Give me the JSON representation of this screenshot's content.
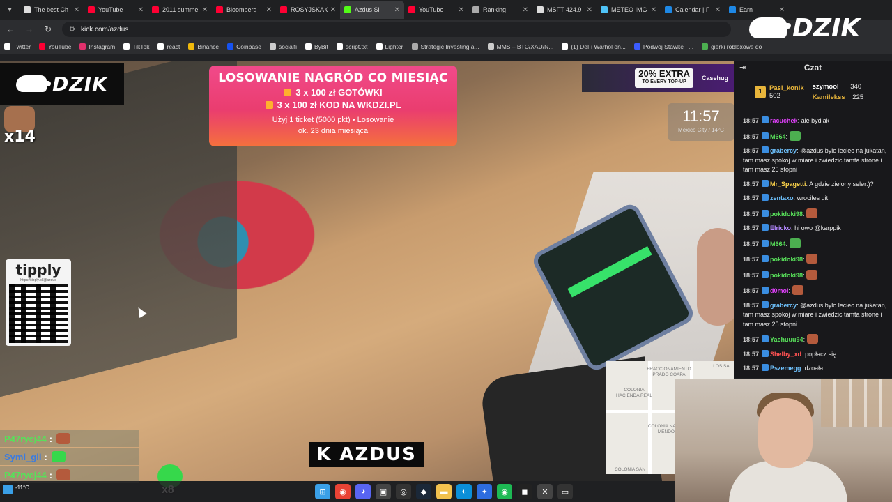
{
  "browser": {
    "tabs": [
      {
        "label": "The best Ch",
        "color": "#dddddd"
      },
      {
        "label": "YouTube",
        "color": "#ff0033"
      },
      {
        "label": "2011 summe",
        "color": "#ff0033"
      },
      {
        "label": "Bloomberg",
        "color": "#ff0033"
      },
      {
        "label": "ROSYJSKA G",
        "color": "#ff0033"
      },
      {
        "label": "Azdus Si",
        "color": "#53fc18"
      },
      {
        "label": "YouTube",
        "color": "#ff0033"
      },
      {
        "label": "Ranking",
        "color": "#aaaaaa"
      },
      {
        "label": "MSFT 424.9",
        "color": "#dddddd"
      },
      {
        "label": "METEO IMG",
        "color": "#4fc3f7"
      },
      {
        "label": "Calendar | F",
        "color": "#1e88e5"
      },
      {
        "label": "Earn",
        "color": "#1e88e5"
      }
    ],
    "active_tab_index": 5,
    "url": "kick.com/azdus",
    "bookmarks": [
      {
        "label": "Twitter",
        "color": "#ffffff"
      },
      {
        "label": "YouTube",
        "color": "#ff0033"
      },
      {
        "label": "Instagram",
        "color": "#e1306c"
      },
      {
        "label": "TikTok",
        "color": "#ffffff"
      },
      {
        "label": "react",
        "color": "#ffffff"
      },
      {
        "label": "Binance",
        "color": "#f0b90b"
      },
      {
        "label": "Coinbase",
        "color": "#1652f0"
      },
      {
        "label": "socialfi",
        "color": "#cccccc"
      },
      {
        "label": "ByBit",
        "color": "#ffffff"
      },
      {
        "label": "script.txt",
        "color": "#ffffff"
      },
      {
        "label": "Lighter",
        "color": "#ffffff"
      },
      {
        "label": "Strategic Investing a...",
        "color": "#aaaaaa"
      },
      {
        "label": "MMS – BTC/XAU/N...",
        "color": "#cccccc"
      },
      {
        "label": "(1) DeFi Warhol on...",
        "color": "#ffffff"
      },
      {
        "label": "Podwój Stawkę | ...",
        "color": "#3b5cff"
      },
      {
        "label": "gierki robloxowe do",
        "color": "#4caf50"
      }
    ]
  },
  "stream": {
    "brand_left": "DZIK",
    "multiplier_top": "x14",
    "promo": {
      "title": "LOSOWANIE NAGRÓD CO MIESIĄC",
      "line1": "3 x 100 zł GOTÓWKI",
      "line2": "3 x 100 zł KOD NA WKDZI.PL",
      "line3": "Użyj 1 ticket (5000 pkt) • Losowanie",
      "line4": "ok. 23 dnia miesiąca"
    },
    "sticker": {
      "extra_top": "20% EXTRA",
      "extra_bottom": "TO EVERY TOP-UP",
      "brand": "Casehug"
    },
    "clock": {
      "time": "11:57",
      "location": "Mexico City / 14°C"
    },
    "tipply": {
      "name": "tipply",
      "url": "https://tipply.pl/@azdus"
    },
    "overlay_chat": [
      {
        "user": "P47rycj44",
        "sep": ":",
        "color": "#58e05a",
        "emote_color": "#b45a3c"
      },
      {
        "user": "Symi_gii",
        "sep": ":",
        "color": "#3a7be0",
        "emote_color": "#36d84b"
      },
      {
        "user": "P47rycj44",
        "sep": ":",
        "color": "#58e05a",
        "emote_color": "#b45a3c"
      }
    ],
    "multiplier_bottom": "x8",
    "streamer_tag": "K AZDUS",
    "map_labels": [
      "FRACCIONAMIENTO PRADO COAPA",
      "COLONIA HACIENDA REAL",
      "COLONIA NARCISO MENDOZA",
      "COLONIA SAN",
      "LOS SA"
    ]
  },
  "brand_right": "DZIK",
  "chat": {
    "title": "Czat",
    "leaders": [
      {
        "rank": "1",
        "name": "Pasi_konik",
        "points": "502",
        "color": "#e8b53b"
      },
      {
        "name": "szymool",
        "points": "340",
        "color": "#ffffff"
      },
      {
        "name": "Kamilekss",
        "points": "225",
        "color": "#e8b53b"
      }
    ],
    "messages": [
      {
        "time": "18:57",
        "user": "racuchek",
        "color": "#e040fb",
        "text": "ale bydlak"
      },
      {
        "time": "18:57",
        "user": "M664",
        "color": "#58e05a",
        "text": "",
        "emote": "#4caf50"
      },
      {
        "time": "18:57",
        "user": "grabercy",
        "color": "#6fc3ff",
        "text": "@azdus bylo leciec na jukatan, tam masz spokoj w miare i zwiedzic tamta strone i tam masz 25 stopni"
      },
      {
        "time": "18:57",
        "user": "Mr_Spagetti",
        "color": "#ffd54a",
        "text": "A gdzie zielony seler:)?"
      },
      {
        "time": "18:57",
        "user": "zentaxo",
        "color": "#6fc3ff",
        "text": "wrociles git"
      },
      {
        "time": "18:57",
        "user": "pokidoki98",
        "color": "#58e05a",
        "text": "",
        "emote": "#b45a3c"
      },
      {
        "time": "18:57",
        "user": "Elricko",
        "color": "#b388ff",
        "text": "hi owo @karppik"
      },
      {
        "time": "18:57",
        "user": "M664",
        "color": "#58e05a",
        "text": "",
        "emote": "#4caf50"
      },
      {
        "time": "18:57",
        "user": "pokidoki98",
        "color": "#58e05a",
        "text": "",
        "emote": "#b45a3c"
      },
      {
        "time": "18:57",
        "user": "pokidoki98",
        "color": "#58e05a",
        "text": "",
        "emote": "#b45a3c"
      },
      {
        "time": "18:57",
        "user": "d0mol",
        "color": "#e040fb",
        "text": "",
        "emote": "#b45a3c"
      },
      {
        "time": "18:57",
        "user": "grabercy",
        "color": "#6fc3ff",
        "text": "@azdus bylo leciec na jukatan, tam masz spokoj w miare i zwiedzic tamta strone i tam masz 25 stopni"
      },
      {
        "time": "18:57",
        "user": "Yachuuu94",
        "color": "#58e05a",
        "text": "",
        "emote": "#b45a3c"
      },
      {
        "time": "18:57",
        "user": "Shelby_xd",
        "color": "#ff5252",
        "text": "popłacz się"
      },
      {
        "time": "18:57",
        "user": "Pszemegg",
        "color": "#6fc3ff",
        "text": "dzoała"
      }
    ]
  },
  "taskbar": {
    "weather_temp": "-11°C",
    "icons": [
      {
        "name": "windows-start-icon",
        "color": "#3aa0e8",
        "glyph": "⊞"
      },
      {
        "name": "chrome-icon",
        "color": "#ea4335",
        "glyph": "◉"
      },
      {
        "name": "discord-icon",
        "color": "#5865f2",
        "glyph": "◕"
      },
      {
        "name": "app-icon",
        "color": "#444444",
        "glyph": "▣"
      },
      {
        "name": "obs-icon",
        "color": "#333333",
        "glyph": "◎"
      },
      {
        "name": "steam-icon",
        "color": "#1b2838",
        "glyph": "◆"
      },
      {
        "name": "folder-icon",
        "color": "#f2c14e",
        "glyph": "▬"
      },
      {
        "name": "edge-icon",
        "color": "#0b8fd9",
        "glyph": "◐"
      },
      {
        "name": "app2-icon",
        "color": "#2d6cdf",
        "glyph": "✦"
      },
      {
        "name": "spotify-icon",
        "color": "#1db954",
        "glyph": "◉"
      },
      {
        "name": "game-icon",
        "color": "#222222",
        "glyph": "◼"
      },
      {
        "name": "xbox-icon",
        "color": "#444444",
        "glyph": "✕"
      },
      {
        "name": "terminal-icon",
        "color": "#333333",
        "glyph": "▭"
      }
    ]
  }
}
